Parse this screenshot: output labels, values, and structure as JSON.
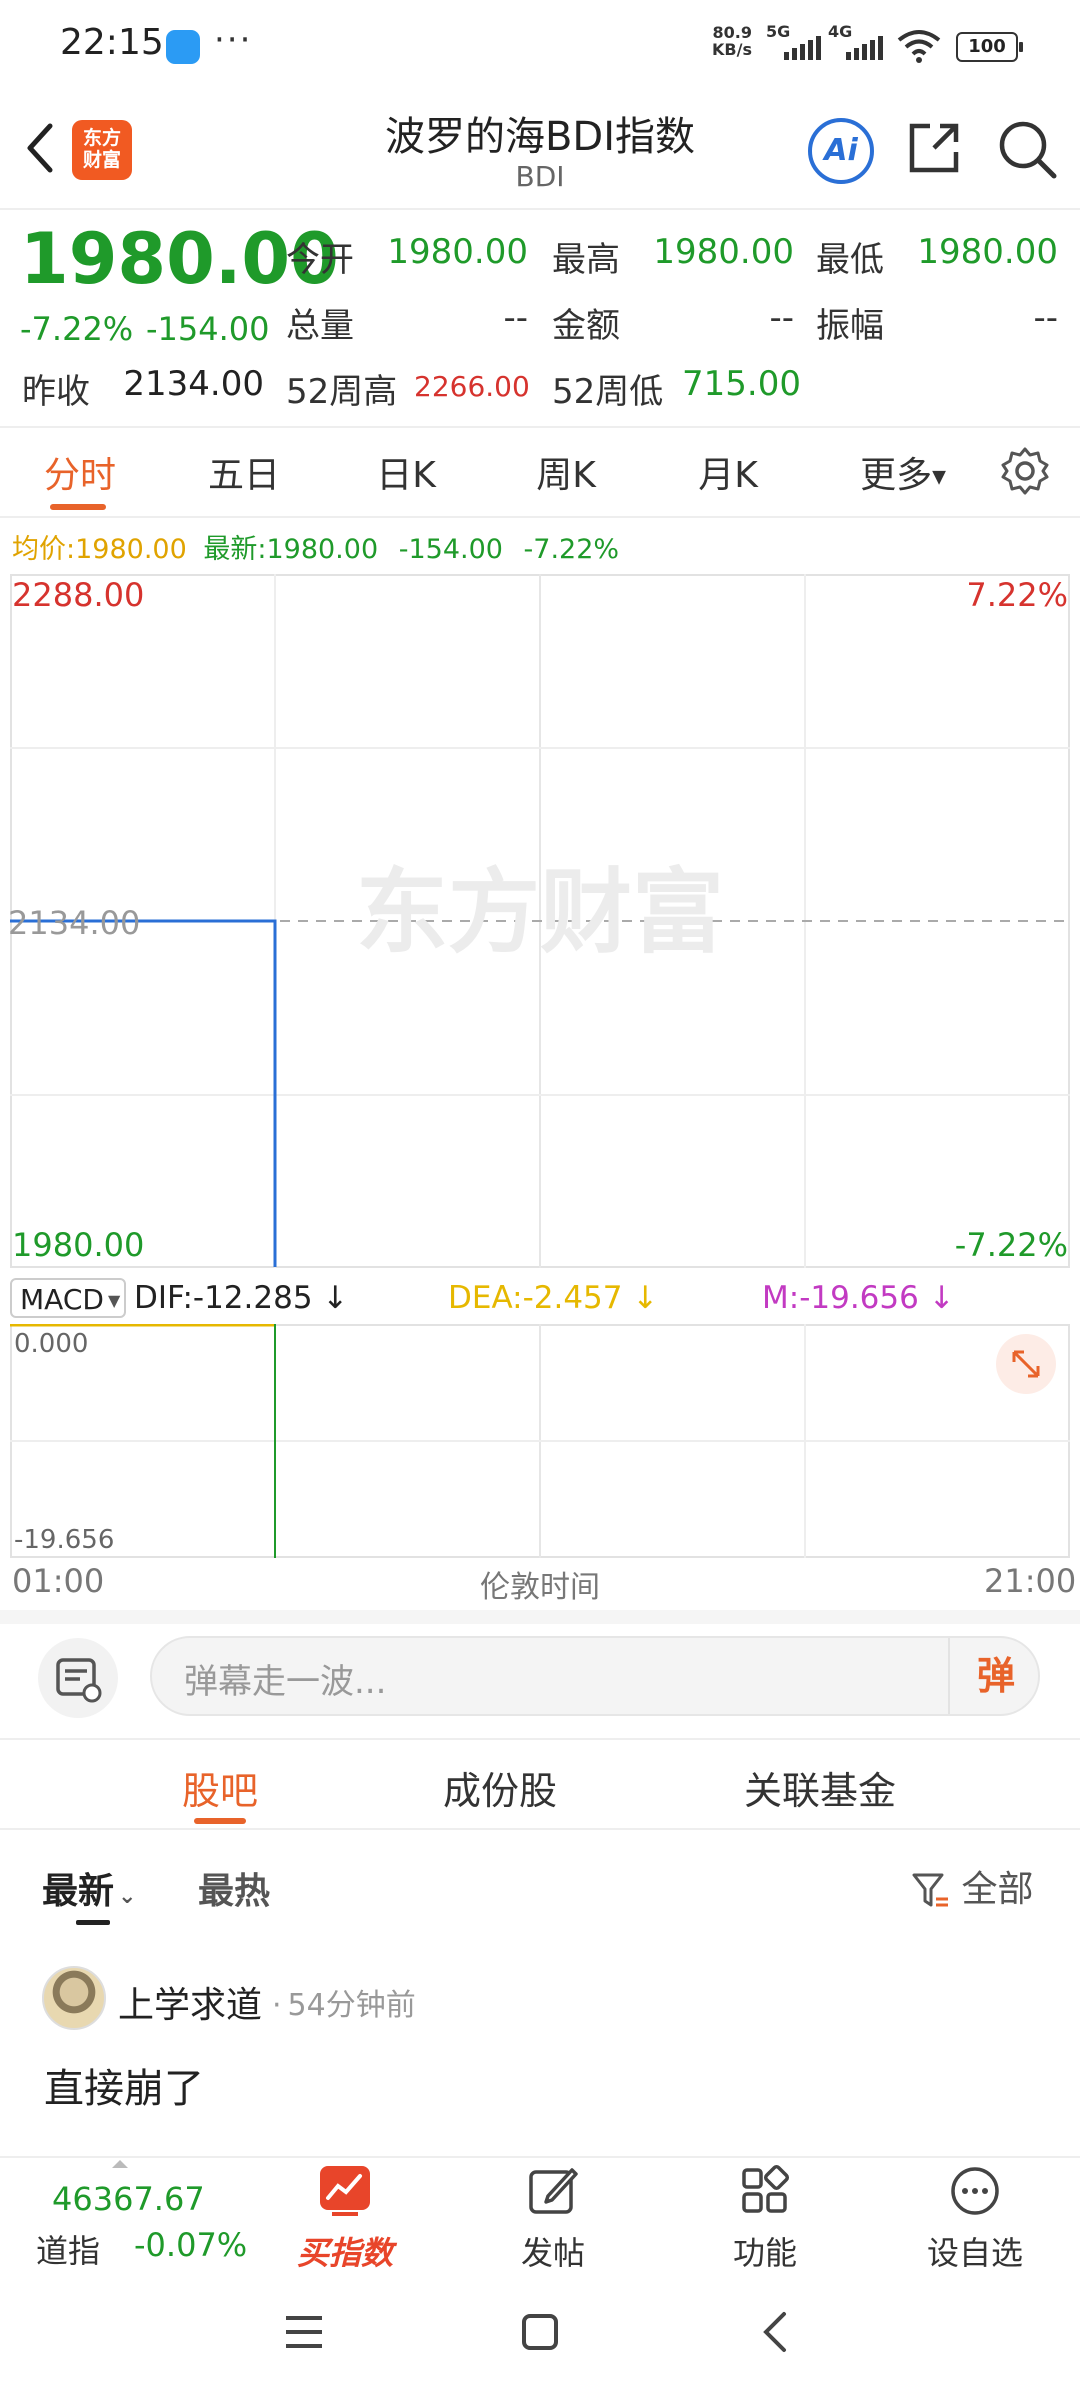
{
  "status_bar": {
    "time": "22:15",
    "more": "···",
    "net_speed": "80.9",
    "net_unit": "KB/s",
    "sig1": "5G",
    "sig2": "4G",
    "battery": "100"
  },
  "header": {
    "logo_text": "东方\n财富",
    "title": "波罗的海BDI指数",
    "subtitle": "BDI",
    "ai_label": "Ai"
  },
  "quote": {
    "price": "1980.00",
    "change_pct": "-7.22%",
    "change": "-154.00",
    "prev_close_label": "昨收",
    "prev_close": "2134.00",
    "open_label": "今开",
    "open": "1980.00",
    "high_label": "最高",
    "high": "1980.00",
    "low_label": "最低",
    "low": "1980.00",
    "volume_label": "总量",
    "volume": "--",
    "amount_label": "金额",
    "amount": "--",
    "amplitude_label": "振幅",
    "amplitude": "--",
    "w52_high_label": "52周高",
    "w52_high": "2266.00",
    "w52_low_label": "52周低",
    "w52_low": "715.00"
  },
  "tabs": [
    "分时",
    "五日",
    "日K",
    "周K",
    "月K",
    "更多"
  ],
  "info_line": {
    "avg_label": "均价:",
    "avg": "1980.00",
    "latest_label": "最新:",
    "latest": "1980.00",
    "chg": "-154.00",
    "pct": "-7.22%"
  },
  "chart_data": {
    "type": "line",
    "y_top": "2288.00",
    "y_mid": "2134.00",
    "y_bottom": "1980.00",
    "pct_top": "7.22%",
    "pct_bottom": "-7.22%",
    "ylim": [
      1980,
      2288
    ],
    "reference": 2134,
    "series": [
      {
        "x": [
          0,
          0.25,
          0.25
        ],
        "y": [
          2134,
          2134,
          1980
        ]
      }
    ],
    "x_start": "01:00",
    "x_mid": "伦敦时间",
    "x_end": "21:00",
    "watermark": "东方财富",
    "macd": {
      "selector": "MACD",
      "dif": "DIF:-12.285",
      "dea": "DEA:-2.457",
      "m": "M:-19.656",
      "top": "0.000",
      "bottom": "-19.656",
      "ylim": [
        -19.656,
        0
      ],
      "m_values": [
        -19.656
      ]
    }
  },
  "comment": {
    "placeholder": "弹幕走一波...",
    "send": "弹"
  },
  "sub_tabs": [
    "股吧",
    "成份股",
    "关联基金"
  ],
  "feed": {
    "tabs": [
      "最新",
      "最热"
    ],
    "filter": "全部",
    "post": {
      "user": "上学求道",
      "time": "54分钟前",
      "text": "直接崩了"
    }
  },
  "bottom_nav": {
    "index_value": "46367.67",
    "index_name": "道指",
    "index_change": "-0.07%",
    "items": [
      "买指数",
      "发帖",
      "功能",
      "设自选"
    ]
  },
  "colors": {
    "up": "#d6332e",
    "down": "#1f9a2a",
    "accent": "#e8632a",
    "avg": "#e0a300",
    "dea": "#e6b800",
    "m": "#c23ac2",
    "line": "#2a6fd6"
  }
}
